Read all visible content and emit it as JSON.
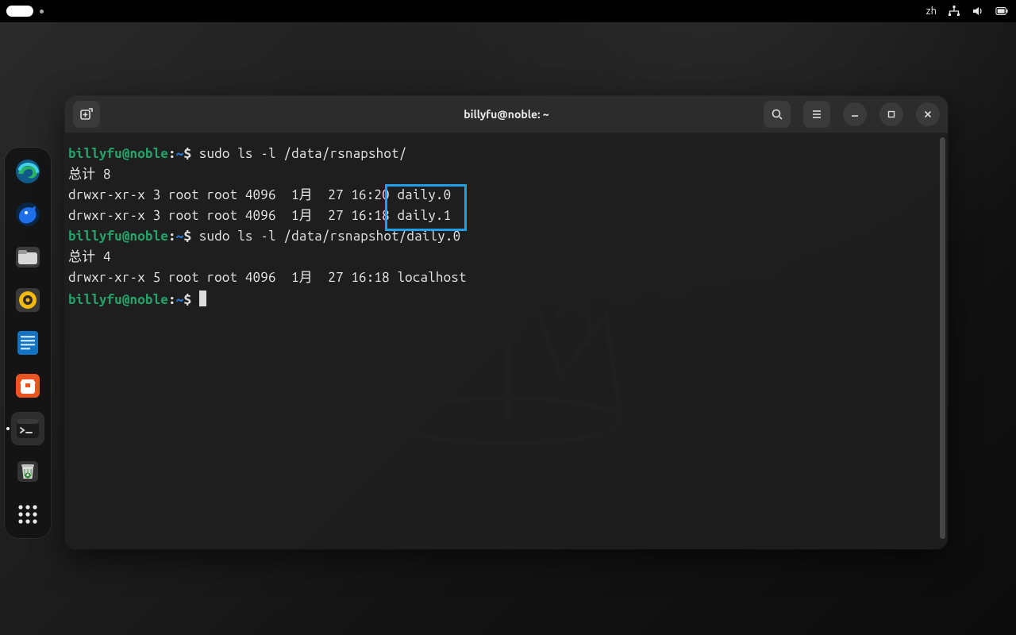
{
  "topbar": {
    "lang_indicator": "zh"
  },
  "dock": {
    "apps": [
      "edge",
      "thunderbird",
      "files",
      "music",
      "document",
      "software",
      "terminal",
      "trash",
      "show-apps"
    ],
    "active_index": 6
  },
  "terminal_window": {
    "title": "billyfu@noble: ~",
    "prompt": {
      "user_host": "billyfu@noble",
      "sep": ":",
      "path": "~",
      "dollar": "$"
    },
    "session": [
      {
        "type": "cmd",
        "text": "sudo ls -l /data/rsnapshot/"
      },
      {
        "type": "out",
        "text": "总计 8"
      },
      {
        "type": "out_hilite",
        "prefix": "drwxr-xr-x 3 root root 4096  1月  27 16:20",
        "hilite": " daily.0 "
      },
      {
        "type": "out_hilite",
        "prefix": "drwxr-xr-x 3 root root 4096  1月  27 16:18",
        "hilite": " daily.1 "
      },
      {
        "type": "cmd",
        "text": "sudo ls -l /data/rsnapshot/daily.0"
      },
      {
        "type": "out",
        "text": "总计 4"
      },
      {
        "type": "out",
        "text": "drwxr-xr-x 5 root root 4096  1月  27 16:18 localhost"
      },
      {
        "type": "cursor"
      }
    ],
    "highlight_box_note": "blue rectangle drawn around 'daily.0' and 'daily.1' in first listing"
  }
}
